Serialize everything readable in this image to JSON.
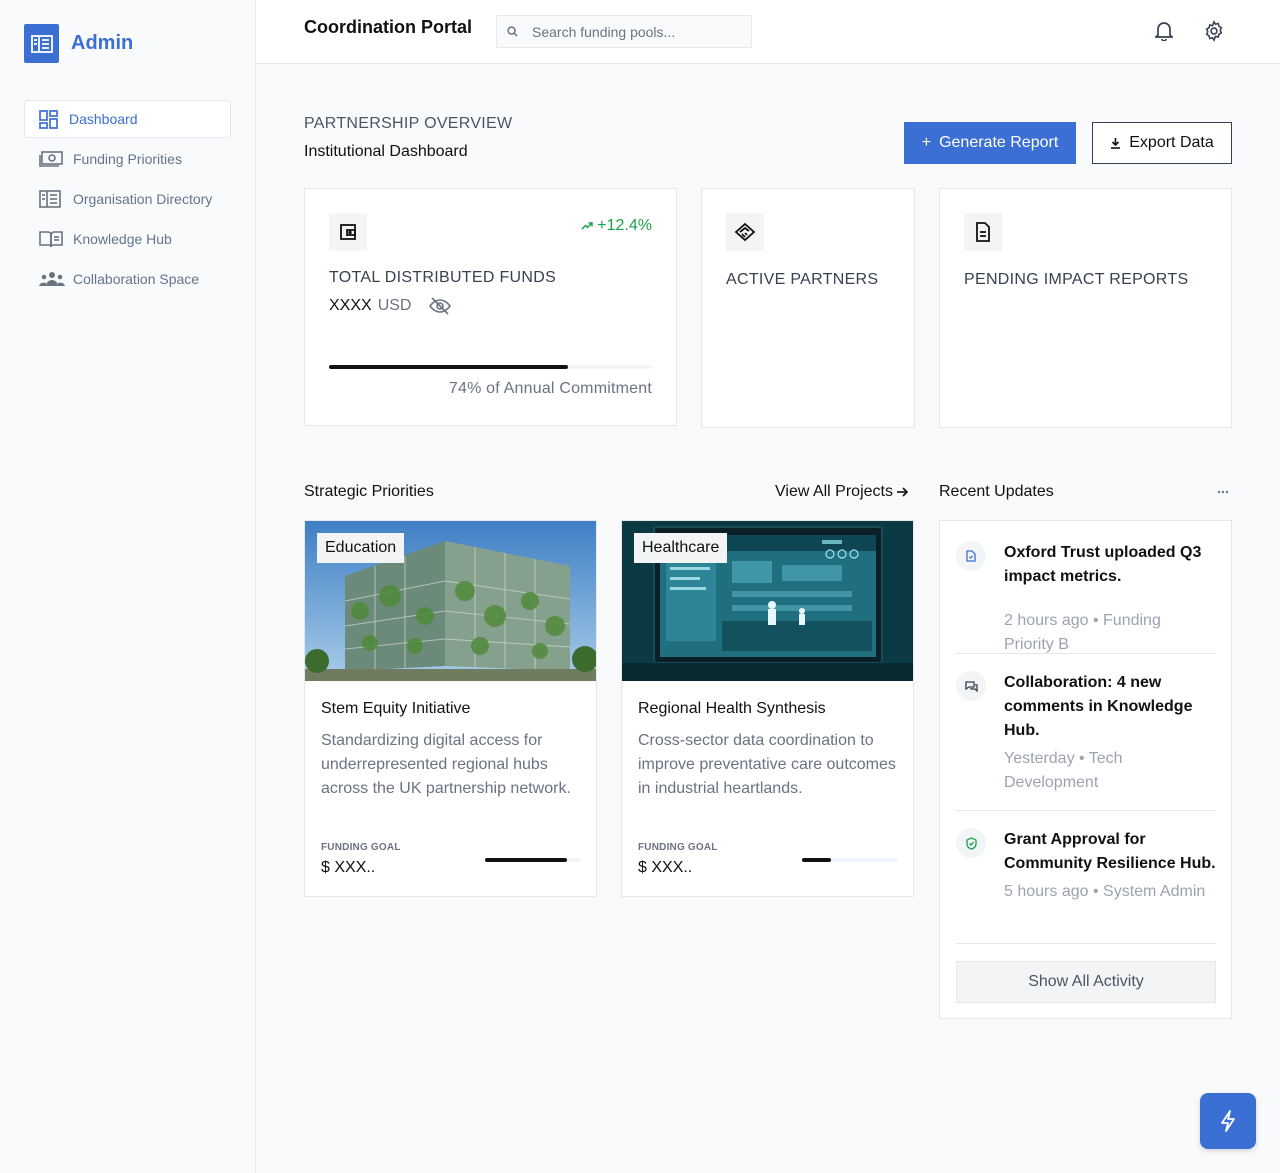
{
  "brand": {
    "name": "Admin",
    "icon": "building-icon",
    "accent": "#3b6fd4"
  },
  "sidebar": {
    "items": [
      {
        "label": "Dashboard",
        "icon": "dashboard-icon",
        "active": true
      },
      {
        "label": "Funding Priorities",
        "icon": "money-icon"
      },
      {
        "label": "Organisation Directory",
        "icon": "building-icon"
      },
      {
        "label": "Knowledge Hub",
        "icon": "book-icon"
      },
      {
        "label": "Collaboration Space",
        "icon": "people-icon"
      }
    ]
  },
  "header": {
    "title": "Coordination Portal",
    "search_placeholder": "Search funding pools...",
    "notifications_icon": "bell-icon",
    "settings_icon": "gear-icon"
  },
  "overview": {
    "eyebrow": "PARTNERSHIP OVERVIEW",
    "title": "Institutional Dashboard",
    "generate_label": "Generate Report",
    "generate_prefix": "+",
    "export_label": "Export Data"
  },
  "stats": {
    "funds": {
      "label": "TOTAL DISTRIBUTED FUNDS",
      "trend": "+12.4%",
      "amount": "XXXX",
      "currency": "USD",
      "progress": 0.74,
      "commitment": "74% of Annual Commitment"
    },
    "partners": {
      "label": "ACTIVE PARTNERS"
    },
    "reports": {
      "label": "PENDING IMPACT REPORTS"
    }
  },
  "priorities": {
    "title": "Strategic Priorities",
    "view_all": "View All Projects",
    "projects": [
      {
        "tag": "Education",
        "title": "Stem Equity Initiative",
        "description": "Standardizing digital access for underrepresented regional hubs across the UK partnership network.",
        "goal_label": "FUNDING GOAL",
        "goal_value": "$ XXX..",
        "progress": 0.85
      },
      {
        "tag": "Healthcare",
        "title": "Regional Health Synthesis",
        "description": "Cross-sector data coordination to improve preventative care outcomes in industrial heartlands.",
        "goal_label": "FUNDING GOAL",
        "goal_value": "$ XXX..",
        "progress": 0.3
      }
    ]
  },
  "updates": {
    "title": "Recent Updates",
    "items": [
      {
        "title": "Oxford Trust uploaded Q3 impact metrics.",
        "time": "2 hours ago",
        "context": "Funding Priority B",
        "icon": "document-icon"
      },
      {
        "title": "Collaboration: 4 new comments in Knowledge Hub.",
        "time": "Yesterday",
        "context": "Tech Development",
        "icon": "chat-icon"
      },
      {
        "title": "Grant Approval for Community Resilience Hub.",
        "time": "5 hours ago",
        "context": "System Admin",
        "icon": "shield-check-icon"
      }
    ],
    "show_all": "Show All Activity"
  },
  "fab_icon": "lightning-icon"
}
